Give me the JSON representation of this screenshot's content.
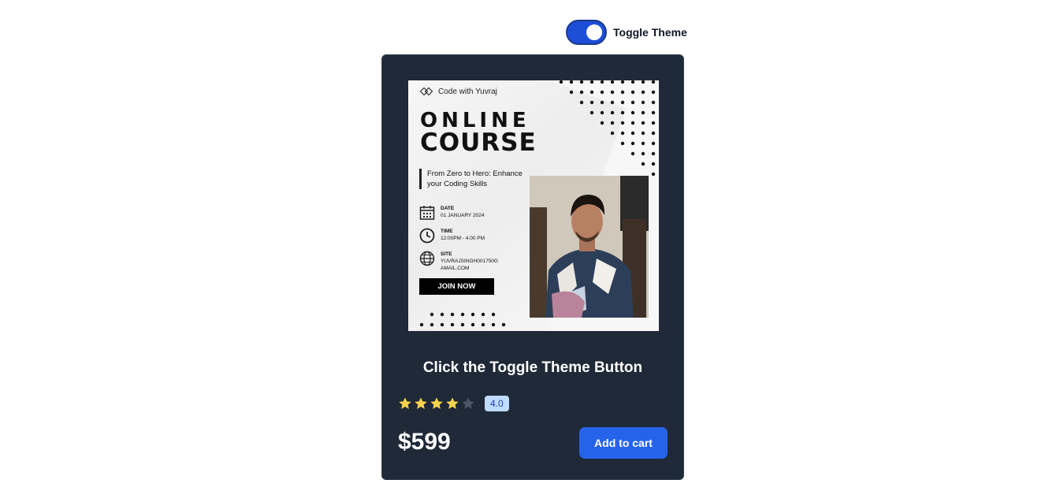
{
  "toggle": {
    "label": "Toggle Theme",
    "checked": true
  },
  "card": {
    "poster": {
      "brand": "Code with Yuvraj",
      "headline_line1": "ONLINE",
      "headline_line2": "COURSE",
      "tagline": "From Zero to Hero: Enhance your Coding Skills",
      "date_label": "DATE",
      "date_value": "01 JANUARY 2024",
      "time_label": "TIME",
      "time_value": "12:00PM - 4.00 PM",
      "site_label": "SITE",
      "site_value": "YUVRAJSINGH001750GAMAIL.COM",
      "cta": "JOIN NOW"
    },
    "title": "Click the Toggle Theme Button",
    "rating": {
      "value": 4,
      "max": 5,
      "label": "4.0"
    },
    "price": "$599",
    "add_to_cart": "Add to cart"
  },
  "colors": {
    "toggle_on": "#1d4ed8",
    "card_bg": "#1f2937",
    "star_filled": "#fcd34d",
    "star_empty": "#4b5563",
    "badge_bg": "#bfdbfe",
    "button_bg": "#2563eb"
  }
}
